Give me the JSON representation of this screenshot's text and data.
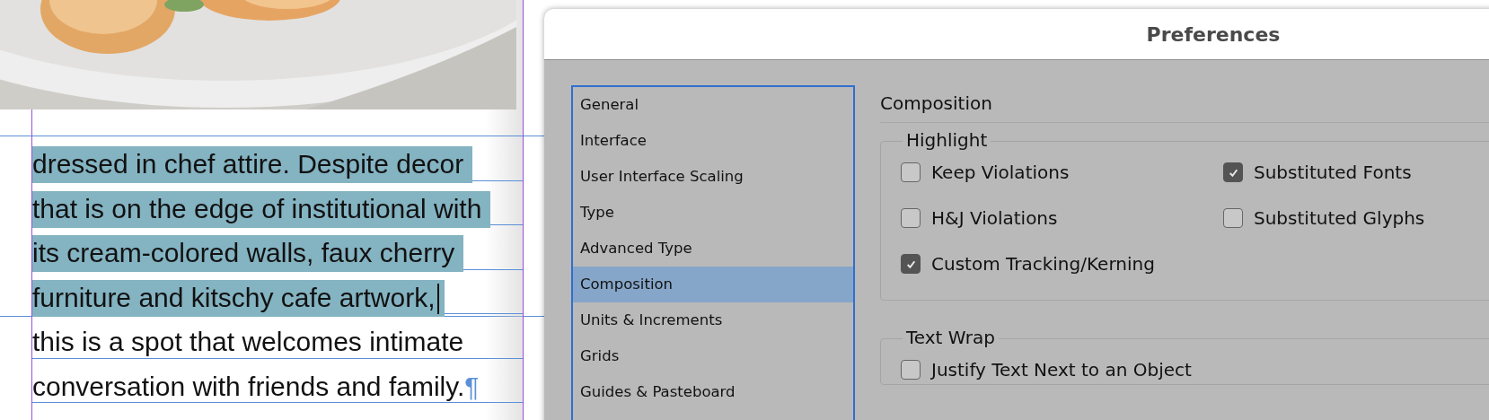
{
  "document": {
    "paragraph_lines": [
      {
        "text": "dressed in chef attire. Despite decor",
        "selected": true,
        "cursor": false
      },
      {
        "text": "that is on the edge of institutional with",
        "selected": true,
        "cursor": false
      },
      {
        "text": "its cream-colored walls, faux cherry",
        "selected": true,
        "cursor": false
      },
      {
        "text": "furniture and kitschy cafe artwork,",
        "selected": true,
        "cursor": true
      },
      {
        "text": "this is a spot that welcomes intimate",
        "selected": false,
        "cursor": false
      },
      {
        "text": "conversation with friends and family.",
        "selected": false,
        "cursor": false
      }
    ],
    "end_mark": "¶"
  },
  "dialog": {
    "title": "Preferences",
    "categories": [
      {
        "label": "General",
        "selected": false
      },
      {
        "label": "Interface",
        "selected": false
      },
      {
        "label": "User Interface Scaling",
        "selected": false
      },
      {
        "label": "Type",
        "selected": false
      },
      {
        "label": "Advanced Type",
        "selected": false
      },
      {
        "label": "Composition",
        "selected": true
      },
      {
        "label": "Units & Increments",
        "selected": false
      },
      {
        "label": "Grids",
        "selected": false
      },
      {
        "label": "Guides & Pasteboard",
        "selected": false
      }
    ],
    "panel_title": "Composition",
    "groups": [
      {
        "title": "Highlight",
        "options": [
          {
            "label": "Keep Violations",
            "checked": false
          },
          {
            "label": "Substituted Fonts",
            "checked": true
          },
          {
            "label": "H&J Violations",
            "checked": false
          },
          {
            "label": "Substituted Glyphs",
            "checked": false
          },
          {
            "label": "Custom Tracking/Kerning",
            "checked": true
          }
        ]
      },
      {
        "title": "Text Wrap",
        "options": [
          {
            "label": "Justify Text Next to an Object",
            "checked": false
          }
        ]
      }
    ]
  }
}
